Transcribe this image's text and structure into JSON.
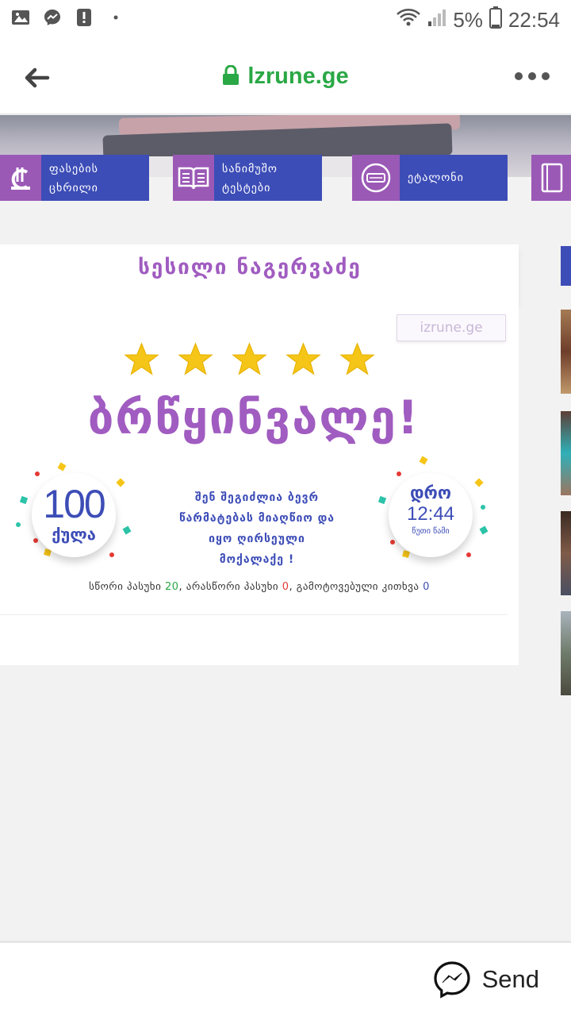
{
  "status_bar": {
    "battery": "5%",
    "time": "22:54",
    "icons": [
      "image-icon",
      "messenger-icon",
      "alert-icon",
      "dot-icon",
      "wifi-icon",
      "signal-icon",
      "battery-icon"
    ]
  },
  "browser": {
    "url": "lzrune.ge",
    "back_icon": "back-arrow-icon",
    "lock_icon": "lock-icon",
    "menu_icon": "more-icon"
  },
  "menu_tiles": [
    {
      "label_line1": "ფასების",
      "label_line2": "ცხრილი",
      "icon": "lari-icon"
    },
    {
      "label_line1": "სანიმუშო",
      "label_line2": "ტესტები",
      "icon": "book-icon"
    },
    {
      "label_line1": "ეტალონი",
      "label_line2": "",
      "icon": "diploma-icon"
    },
    {
      "label_line1": "",
      "label_line2": "",
      "icon": "notebook-icon"
    }
  ],
  "result": {
    "student_name": "სესილი ნაგერვაძე",
    "watermark": "izrune.ge",
    "stars": 5,
    "headline": "ბრწყინვალე!",
    "score_value": "100",
    "score_unit": "ქულა",
    "message_line1": "შენ შეგიძლია ბევრ",
    "message_line2": "წარმატებას მიაღწიო და",
    "message_line3": "იყო ღირსეული",
    "message_line4": "მოქალაქე !",
    "time_label": "დრო",
    "time_value": "12:44",
    "time_unit": "წუთი წამი",
    "correct_label": "სწორი პასუხი",
    "correct_count": "20",
    "wrong_label": "არასწორი პასუხი",
    "wrong_count": "0",
    "skipped_label": "გამოტოვებული კითხვა",
    "skipped_count": "0"
  },
  "send_bar": {
    "send_label": "Send",
    "icon": "messenger-icon"
  },
  "colors": {
    "purple": "#a05cc0",
    "blue": "#3d4db7",
    "green": "#2aa845",
    "red": "#e53935",
    "star": "#f5c518"
  }
}
